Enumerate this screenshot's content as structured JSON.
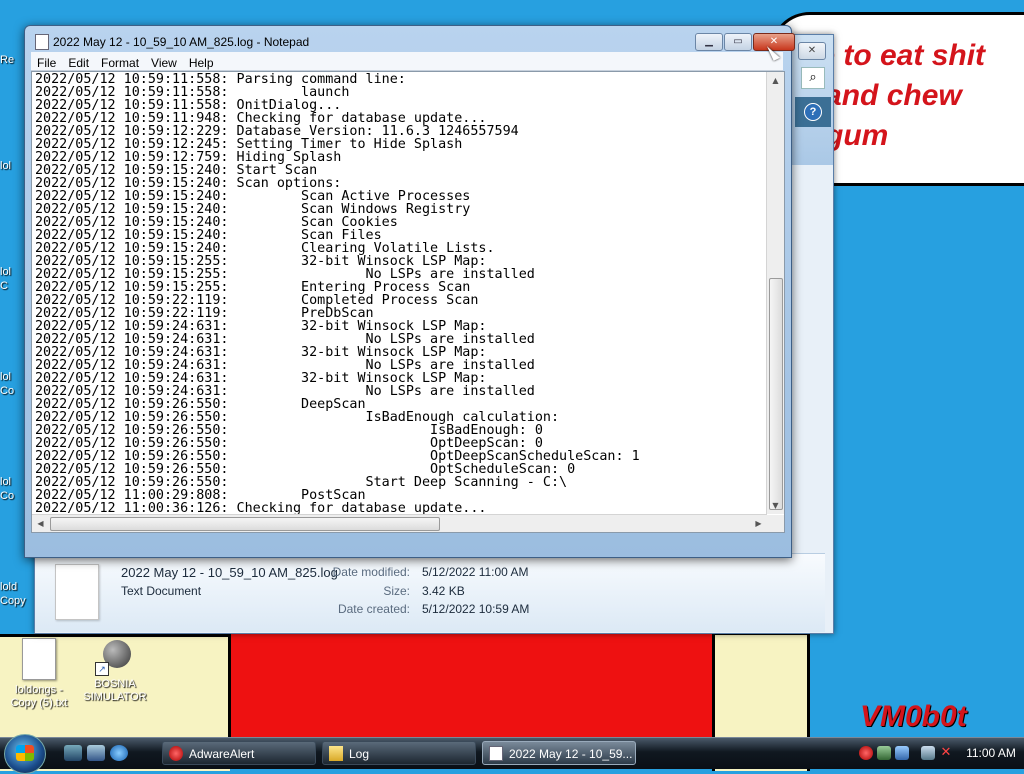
{
  "wallpaper": {
    "bubble_text": "ne to eat shit\ne and chew\ne gum",
    "signature": "VM0b0t",
    "colors": {
      "sky": "#27a0e0",
      "red": "#ee1111",
      "text_red": "#d4141b",
      "cream": "#f7f3c2"
    }
  },
  "desktop": {
    "icons": [
      {
        "label": "loldongs - Copy (5).txt",
        "icon": "text-file-icon"
      },
      {
        "label": "BOSNIA SIMULATOR",
        "icon": "mine-shortcut-icon"
      }
    ],
    "edge_labels": [
      "Re",
      "lol",
      "lol\nC",
      "lol\nCo",
      "lol\nCo",
      "lold\nCopy"
    ]
  },
  "explorer": {
    "details": {
      "file_name": "2022 May 12 - 10_59_10 AM_825.log",
      "file_type": "Text Document",
      "date_modified_label": "Date modified:",
      "date_modified": "5/12/2022 11:00 AM",
      "size_label": "Size:",
      "size": "3.42 KB",
      "date_created_label": "Date created:",
      "date_created": "5/12/2022 10:59 AM"
    }
  },
  "notepad": {
    "title": "2022 May 12 - 10_59_10 AM_825.log - Notepad",
    "menu": [
      "File",
      "Edit",
      "Format",
      "View",
      "Help"
    ],
    "content": "2022/05/12 10:59:11:558: Parsing command line:\n2022/05/12 10:59:11:558:         launch\n2022/05/12 10:59:11:558: OnitDialog...\n2022/05/12 10:59:11:948: Checking for database update...\n2022/05/12 10:59:12:229: Database Version: 11.6.3 1246557594\n2022/05/12 10:59:12:245: Setting Timer to Hide Splash\n2022/05/12 10:59:12:759: Hiding Splash\n2022/05/12 10:59:15:240: Start Scan\n2022/05/12 10:59:15:240: Scan options:\n2022/05/12 10:59:15:240:         Scan Active Processes\n2022/05/12 10:59:15:240:         Scan Windows Registry\n2022/05/12 10:59:15:240:         Scan Cookies\n2022/05/12 10:59:15:240:         Scan Files\n2022/05/12 10:59:15:240:         Clearing Volatile Lists.\n2022/05/12 10:59:15:255:         32-bit Winsock LSP Map:\n2022/05/12 10:59:15:255:                 No LSPs are installed\n2022/05/12 10:59:15:255:         Entering Process Scan\n2022/05/12 10:59:22:119:         Completed Process Scan\n2022/05/12 10:59:22:119:         PreDbScan\n2022/05/12 10:59:24:631:         32-bit Winsock LSP Map:\n2022/05/12 10:59:24:631:                 No LSPs are installed\n2022/05/12 10:59:24:631:         32-bit Winsock LSP Map:\n2022/05/12 10:59:24:631:                 No LSPs are installed\n2022/05/12 10:59:24:631:         32-bit Winsock LSP Map:\n2022/05/12 10:59:24:631:                 No LSPs are installed\n2022/05/12 10:59:26:550:         DeepScan\n2022/05/12 10:59:26:550:                 IsBadEnough calculation:\n2022/05/12 10:59:26:550:                         IsBadEnough: 0\n2022/05/12 10:59:26:550:                         OptDeepScan: 0\n2022/05/12 10:59:26:550:                         OptDeepScanScheduleScan: 1\n2022/05/12 10:59:26:550:                         OptScheduleScan: 0\n2022/05/12 10:59:26:550:                 Start Deep Scanning - C:\\\n2022/05/12 11:00:29:808:         PostScan\n2022/05/12 11:00:36:126: Checking for database update..."
  },
  "taskbar": {
    "tasks": [
      {
        "label": "AdwareAlert",
        "icon": "adwarealert-icon",
        "active": false
      },
      {
        "label": "Log",
        "icon": "folder-icon",
        "active": false
      },
      {
        "label": "2022 May 12 - 10_59...",
        "icon": "notepad-icon",
        "active": true
      }
    ],
    "clock": "11:00 AM"
  }
}
